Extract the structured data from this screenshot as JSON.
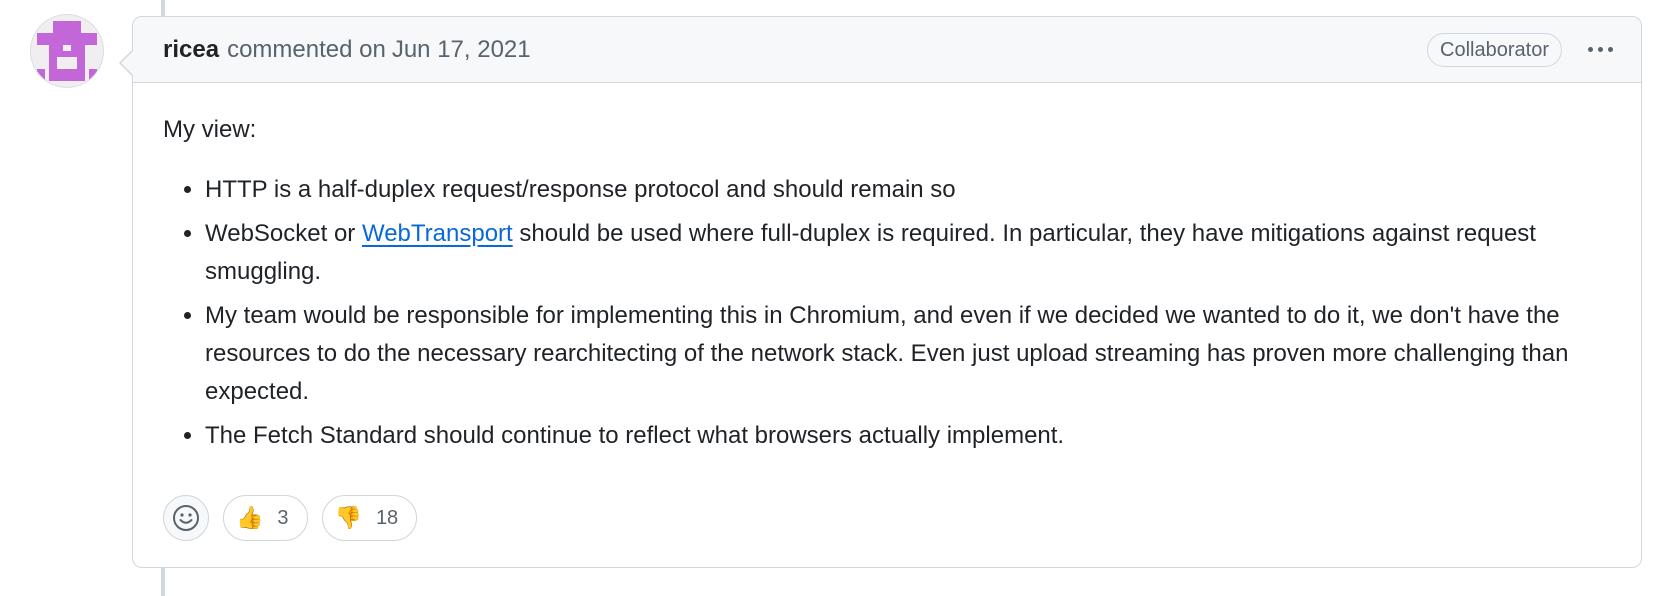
{
  "comment": {
    "author": "ricea",
    "action": "commented on",
    "date": "Jun 17, 2021",
    "role_badge": "Collaborator",
    "menu_icon": "kebab-horizontal-icon",
    "avatar_color": "#c366d8",
    "body": {
      "intro": "My view:",
      "bullets": [
        {
          "text": "HTTP is a half-duplex request/response protocol and should remain so"
        },
        {
          "before": "WebSocket or ",
          "link": "WebTransport",
          "after": " should be used where full-duplex is required. In particular, they have mitigations against request smuggling."
        },
        {
          "text": "My team would be responsible for implementing this in Chromium, and even if we decided we wanted to do it, we don't have the resources to do the necessary rearchitecting of the network stack. Even just upload streaming has proven more challenging than expected."
        },
        {
          "text": "The Fetch Standard should continue to reflect what browsers actually implement."
        }
      ]
    },
    "reactions": {
      "add_icon": "smiley-icon",
      "items": [
        {
          "emoji": "👍",
          "icon": "thumbs-up-icon",
          "count": "3"
        },
        {
          "emoji": "👎",
          "icon": "thumbs-down-icon",
          "count": "18"
        }
      ]
    }
  },
  "colors": {
    "link": "#0969da",
    "border": "#d0d7de",
    "header_bg": "#f6f8fa",
    "muted_text": "#59636e"
  }
}
